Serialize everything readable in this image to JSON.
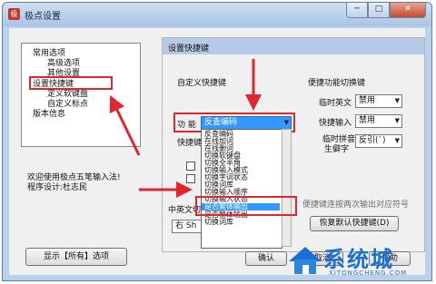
{
  "window": {
    "title": "极点设置",
    "app_icon": "极",
    "buttons": [
      "─",
      "□",
      "✕"
    ]
  },
  "tree": {
    "items": [
      {
        "label": "常用选项",
        "level": 0
      },
      {
        "label": "高级选项",
        "level": 1
      },
      {
        "label": "其他设置",
        "level": 1
      },
      {
        "label": "设置快捷键",
        "level": 0
      },
      {
        "label": "定义软键盘",
        "level": 1
      },
      {
        "label": "自定义标点",
        "level": 1
      },
      {
        "label": "版本信息",
        "level": 0
      }
    ]
  },
  "welcome": {
    "line1": "欢迎使用极点五笔输入法!",
    "line2": "程序设计:杜志民"
  },
  "show_all_button": "显示【所有】选项",
  "panel": {
    "title": "设置快捷键",
    "custom_section": "自定义快捷键",
    "func_label": "功 能",
    "func_value": "反查编码",
    "shortcut_label": "快捷键",
    "zhongying_label": "中英文切",
    "right_button_label": "右 Sh",
    "dropdown_items": [
      "反查编码",
      "在线加词",
      "在线删词",
      "切换软键盘",
      "切换全半角",
      "切换输入模式",
      "切换字词状态",
      "切换词库",
      "切换输入顺序",
      "切换输入状态",
      "是否繁体输出",
      "切换词库"
    ],
    "dropdown_selected": "是否繁体输出",
    "convenient_section": "便捷功能切换键",
    "temp_english_label": "临时英文",
    "temp_english_value": "禁用",
    "shortcut_input_label": "快捷输入",
    "shortcut_input_value": "禁用",
    "temp_pinyin_label": "临时拼音",
    "temp_pinyin_label2": "生僻字",
    "temp_pinyin_value": "反引(`)",
    "hint": "便捷键连按两次输出对应符号",
    "restore_button": "恢复默认快捷键(D)"
  },
  "buttons": {
    "ok": "确认",
    "cancel": "取消",
    "help": "帮助"
  },
  "watermark": {
    "text": "系统城",
    "sub": "XITONGCHENG.COM"
  },
  "colors": {
    "highlight": "#e3262e",
    "selection": "#3399ff"
  }
}
